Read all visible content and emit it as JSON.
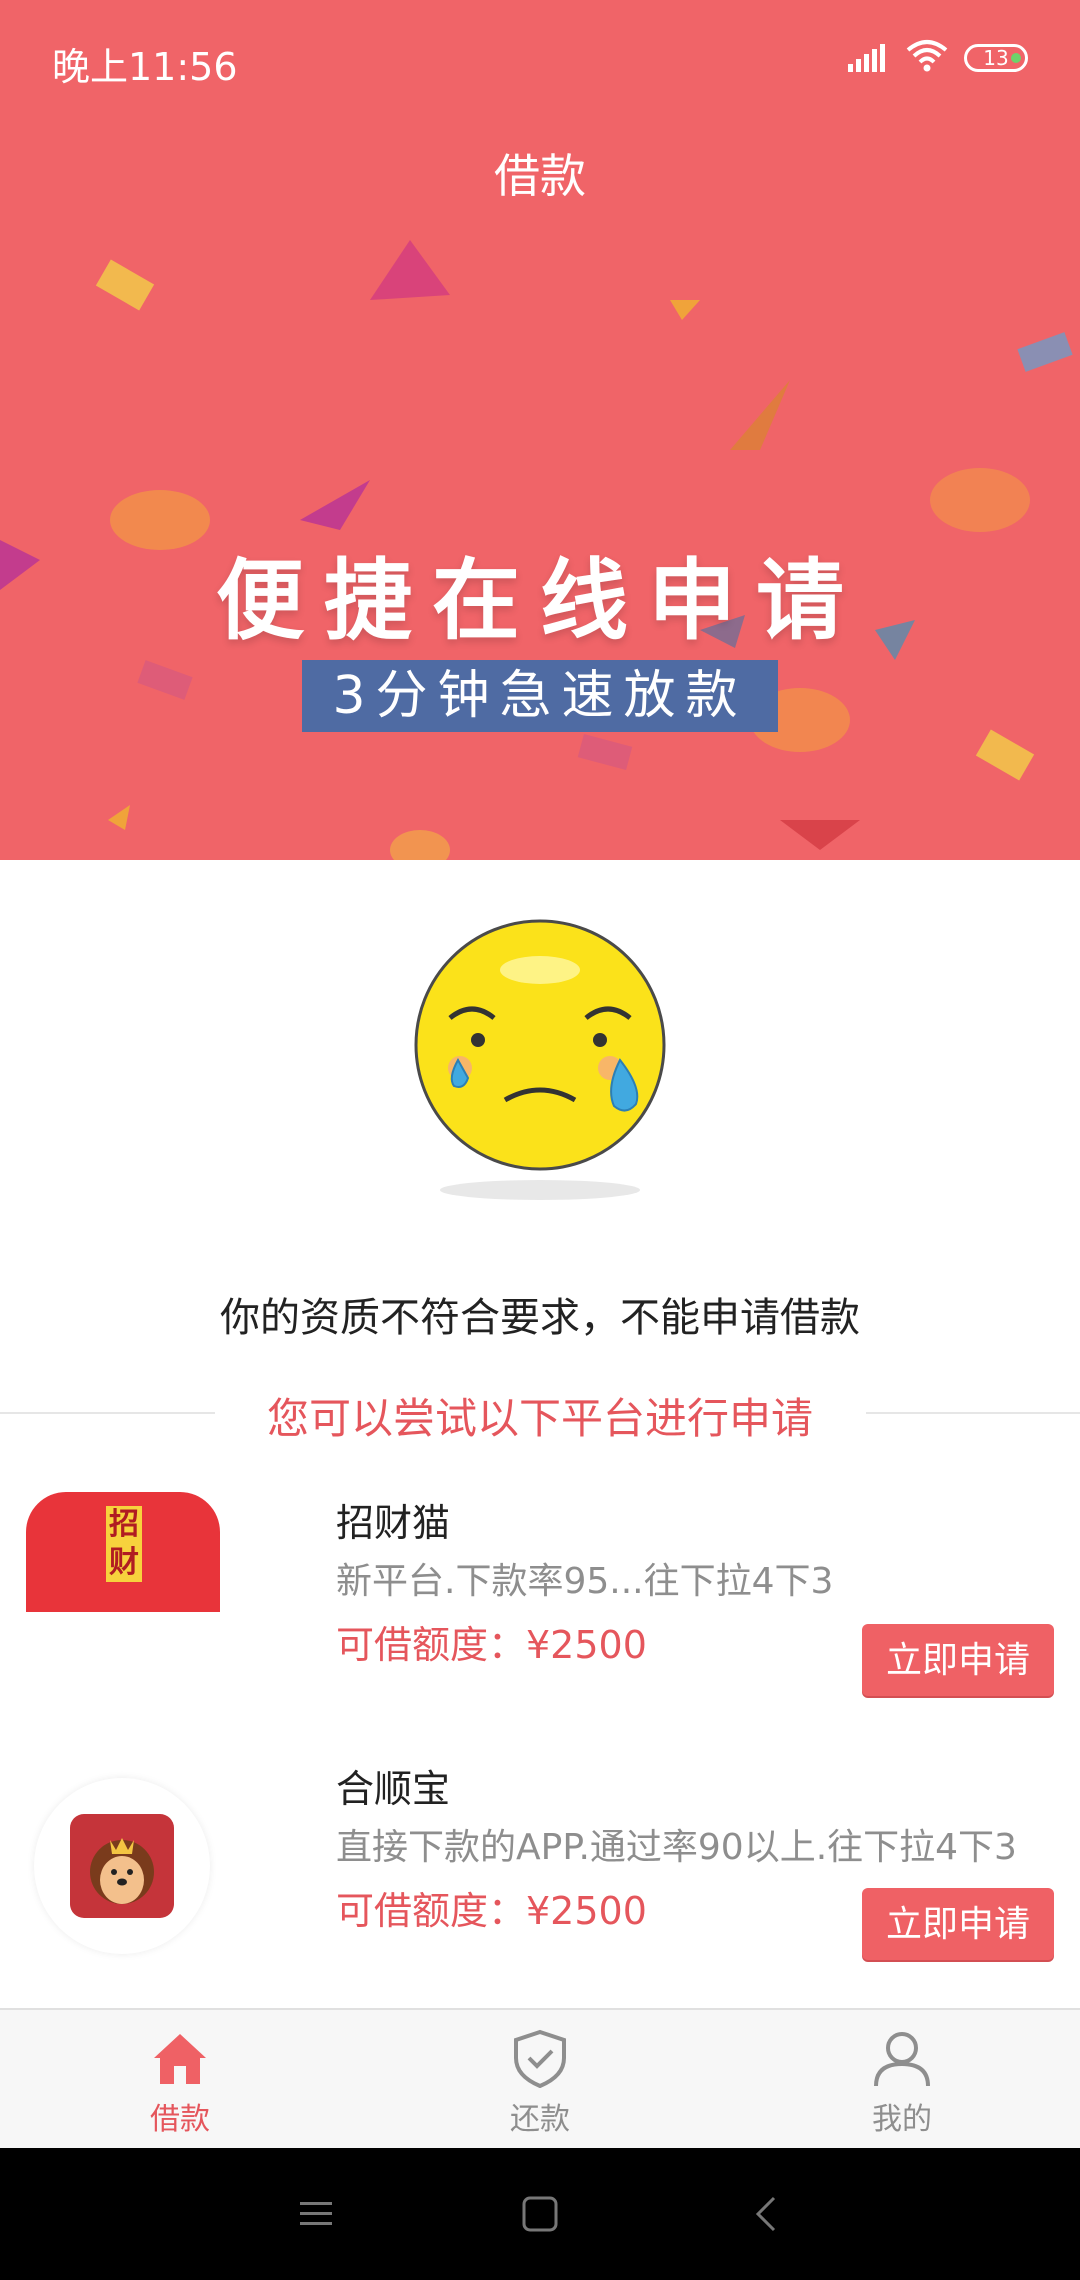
{
  "status": {
    "time": "晚上11:56",
    "battery": "13"
  },
  "header": {
    "title": "借款"
  },
  "banner": {
    "main": "便捷在线申请",
    "sub": "3分钟急速放款"
  },
  "message": {
    "reject": "你的资质不符合要求，不能申请借款",
    "try": "您可以尝试以下平台进行申请"
  },
  "platforms": [
    {
      "logo_text": "招财",
      "name": "招财猫",
      "desc": "新平台.下款率95...往下拉4下3",
      "amount": "可借额度：¥2500",
      "button": "立即申请"
    },
    {
      "name": "合顺宝",
      "desc": "直接下款的APP.通过率90以上.往下拉4下3",
      "amount": "可借额度：¥2500",
      "button": "立即申请"
    }
  ],
  "tabs": [
    {
      "label": "借款",
      "icon": "home-icon",
      "active": true
    },
    {
      "label": "还款",
      "icon": "shield-check-icon",
      "active": false
    },
    {
      "label": "我的",
      "icon": "user-icon",
      "active": false
    }
  ],
  "colors": {
    "brand": "#f06468",
    "accent": "#e5565c",
    "inactive": "#8e8e8e"
  }
}
